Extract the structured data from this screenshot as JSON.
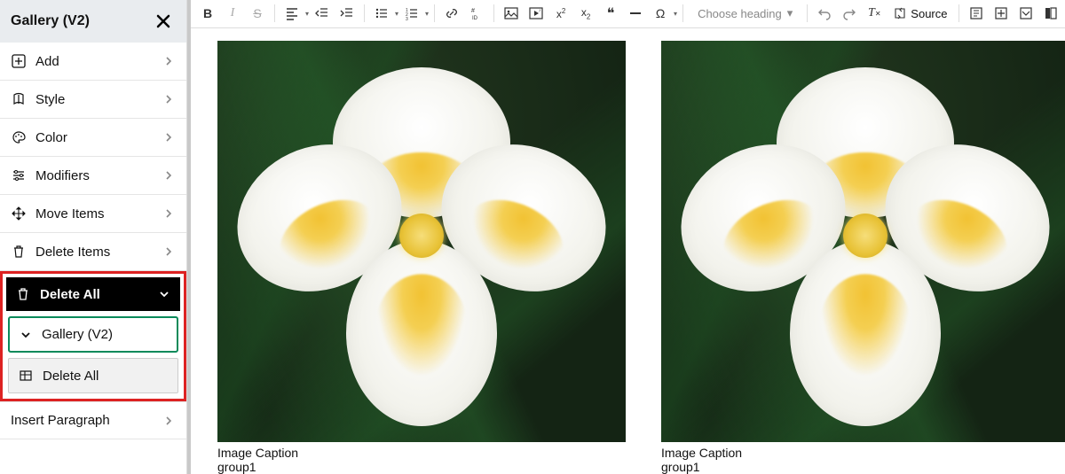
{
  "sidebar": {
    "title": "Gallery (V2)",
    "items": [
      {
        "label": "Add"
      },
      {
        "label": "Style"
      },
      {
        "label": "Color"
      },
      {
        "label": "Modifiers"
      },
      {
        "label": "Move Items"
      },
      {
        "label": "Delete Items"
      }
    ],
    "delete_all": {
      "label": "Delete All",
      "sub_gallery_label": "Gallery (V2)",
      "sub_delete_label": "Delete All"
    },
    "insert_paragraph": {
      "label": "Insert Paragraph"
    }
  },
  "toolbar": {
    "heading_placeholder": "Choose heading",
    "source_label": "Source"
  },
  "gallery": {
    "items": [
      {
        "caption": "Image Caption",
        "group": "group1"
      },
      {
        "caption": "Image Caption",
        "group": "group1"
      }
    ]
  }
}
